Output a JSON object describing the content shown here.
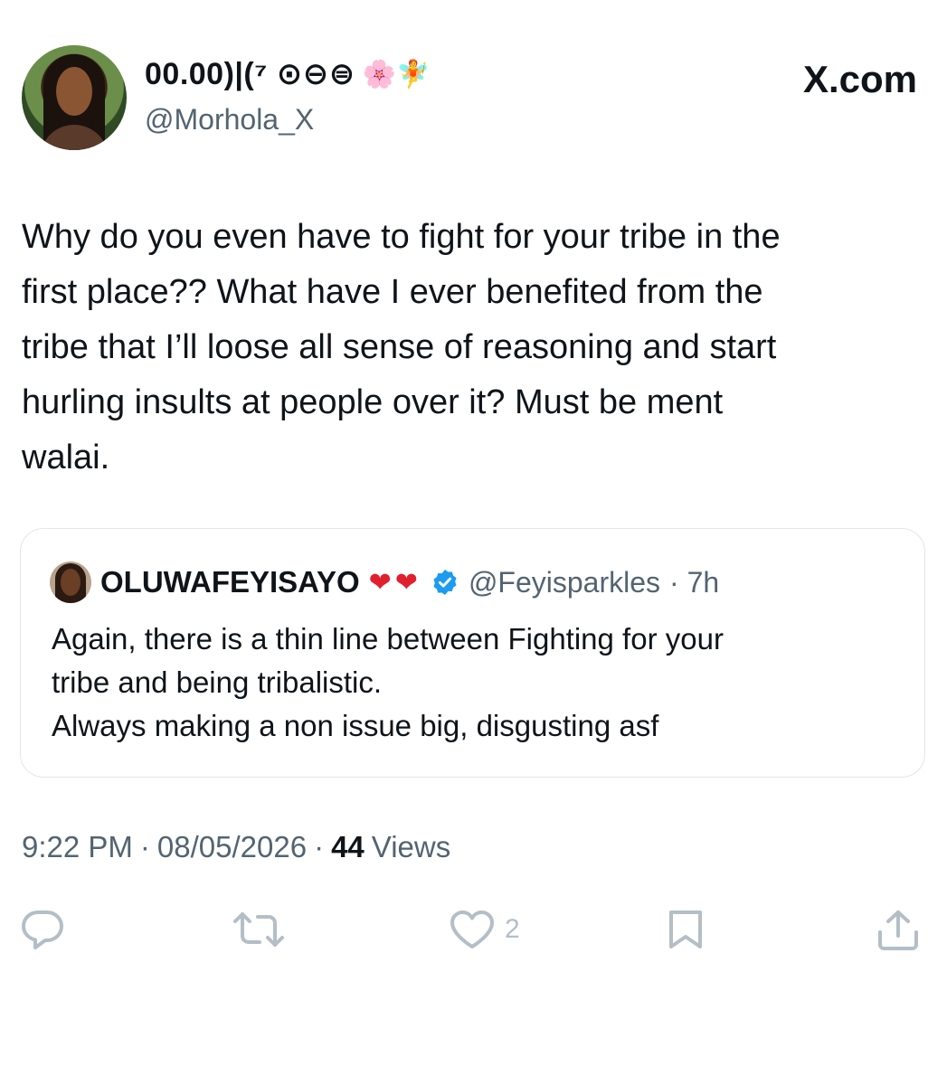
{
  "author": {
    "display_name": "00.00)|(⁷ ⊙⊖⊜",
    "name_emojis": "🌸🧚",
    "handle": "@Morhola_X"
  },
  "brand": "X.com",
  "tweet": {
    "text": "Why do you even have to fight for your tribe in the\nfirst place?? What have I ever benefited from the\ntribe that I’ll loose all sense of reasoning and start\nhurling insults at people over it? Must be ment\nwalai."
  },
  "quoted": {
    "name": "OLUWAFEYISAYO",
    "hearts": "❤❤",
    "handle": "@Feyisparkles",
    "time": "· 7h",
    "text": "Again, there is a thin line between Fighting for your\ntribe and being tribalistic.\nAlways making a non issue big, disgusting asf"
  },
  "meta": {
    "time": "9:22 PM",
    "sep1": "·",
    "date": "08/05/2026",
    "sep2": "·",
    "views_count": "44",
    "views_label": "Views"
  },
  "actions": {
    "like_count": "2"
  },
  "colors": {
    "text": "#0f1419",
    "secondary": "#536471",
    "icon": "#b4bec6",
    "verified": "#1d9bf0",
    "heart": "#e0202e"
  }
}
